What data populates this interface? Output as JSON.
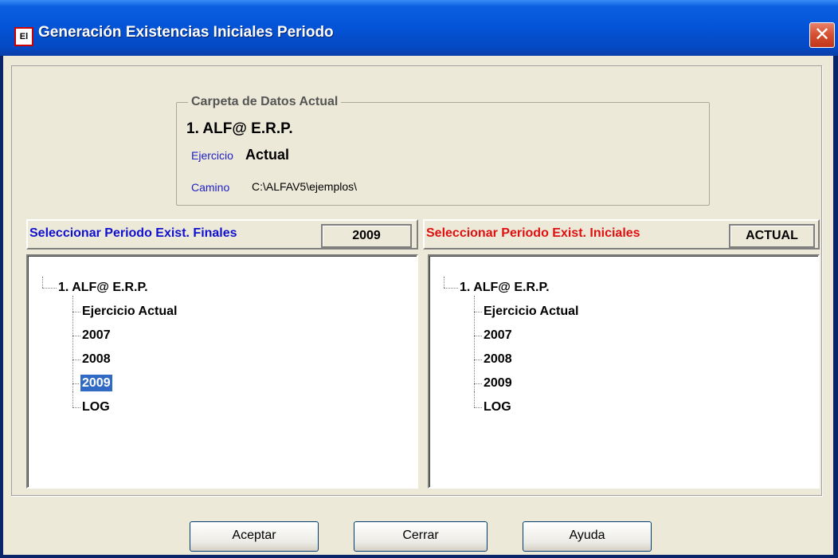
{
  "window": {
    "icon_text": "El",
    "title": "Generación Existencias Iniciales Periodo",
    "close_glyph": "✕"
  },
  "current_folder": {
    "legend": "Carpeta de Datos Actual",
    "name": "1. ALF@ E.R.P.",
    "ejercicio_label": "Ejercicio",
    "ejercicio_value": "Actual",
    "camino_label": "Camino",
    "camino_value": "C:\\ALFAV5\\ejemplos\\"
  },
  "left_panel": {
    "label": "Seleccionar Periodo Exist. Finales",
    "label_color": "#1010d0",
    "value": "2009",
    "tree": {
      "root": "1. ALF@ E.R.P.",
      "children": [
        "Ejercicio Actual",
        "2007",
        "2008",
        "2009",
        "LOG"
      ],
      "selected": "2009"
    }
  },
  "right_panel": {
    "label": "Seleccionar Periodo Exist. Iniciales",
    "label_color": "#e01010",
    "value": "ACTUAL",
    "tree": {
      "root": "1. ALF@ E.R.P.",
      "children": [
        "Ejercicio Actual",
        "2007",
        "2008",
        "2009",
        "LOG"
      ],
      "selected": ""
    }
  },
  "buttons": {
    "aceptar": "Aceptar",
    "cerrar": "Cerrar",
    "ayuda": "Ayuda"
  }
}
